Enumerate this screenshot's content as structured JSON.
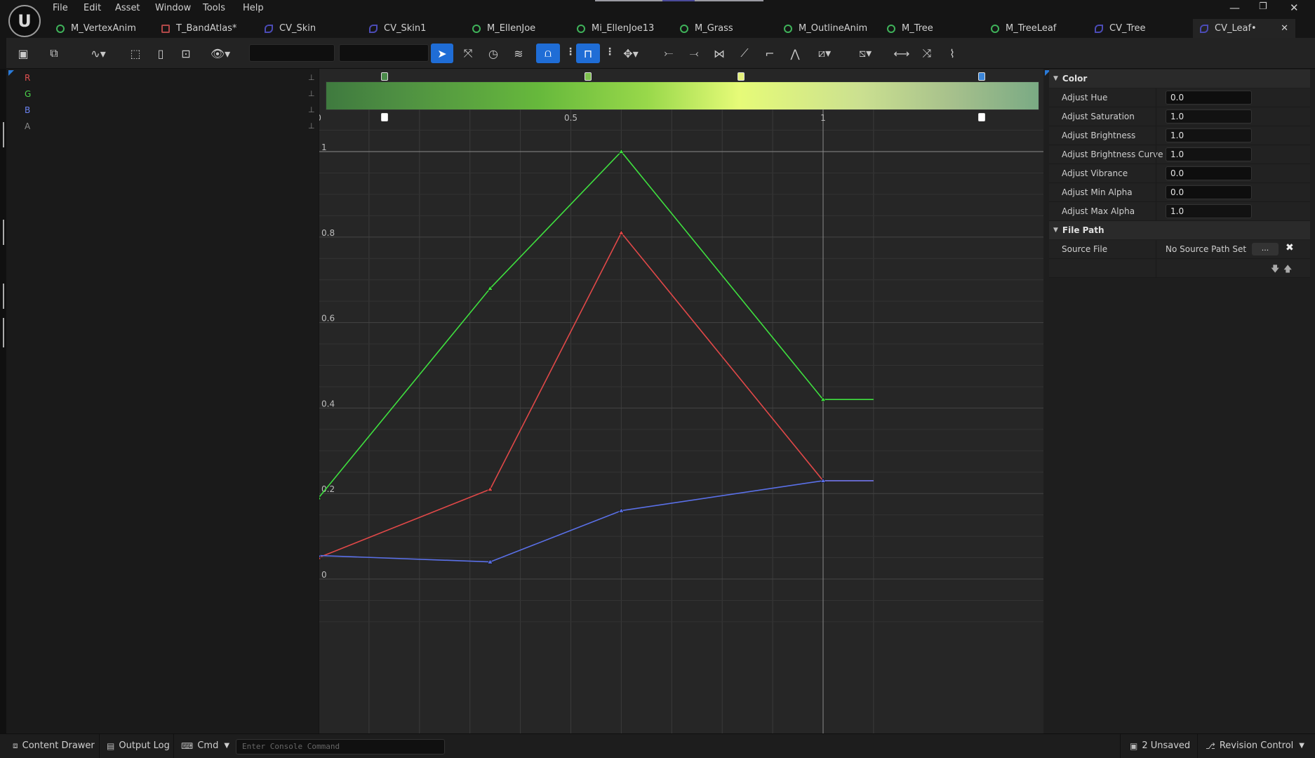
{
  "app": {
    "name": "Unreal Editor"
  },
  "menu": [
    "File",
    "Edit",
    "Asset",
    "Window",
    "Tools",
    "Help"
  ],
  "tabs": [
    {
      "label": "M_VertexAnim",
      "kind": "material"
    },
    {
      "label": "T_BandAtlas*",
      "kind": "texture"
    },
    {
      "label": "CV_Skin",
      "kind": "curve"
    },
    {
      "label": "CV_Skin1",
      "kind": "curve"
    },
    {
      "label": "M_EllenJoe",
      "kind": "material"
    },
    {
      "label": "Mi_EllenJoe13",
      "kind": "material"
    },
    {
      "label": "M_Grass",
      "kind": "material"
    },
    {
      "label": "M_OutlineAnim",
      "kind": "material"
    },
    {
      "label": "M_Tree",
      "kind": "material"
    },
    {
      "label": "M_TreeLeaf",
      "kind": "material"
    },
    {
      "label": "CV_Tree",
      "kind": "curve"
    },
    {
      "label": "CV_Leaf•",
      "kind": "curve",
      "active": true
    }
  ],
  "channels": [
    {
      "label": "R",
      "color": "#e05050"
    },
    {
      "label": "G",
      "color": "#4bd44b"
    },
    {
      "label": "B",
      "color": "#6a82f0"
    },
    {
      "label": "A",
      "color": "#8a8a8a"
    }
  ],
  "gradient_stops_top": [
    {
      "color": "#4a8a4a"
    },
    {
      "color": "#7ec04e"
    },
    {
      "color": "#e4f07a"
    },
    {
      "color": "#3c86d8"
    }
  ],
  "chart_data": {
    "type": "line",
    "title": "",
    "x_ticks": [
      "0",
      "0.5",
      "1"
    ],
    "y_ticks": [
      "0",
      "0.2",
      "0.4",
      "0.6",
      "0.8",
      "1"
    ],
    "xlim": [
      -0.1,
      1.1
    ],
    "ylim": [
      -0.08,
      1.1
    ],
    "series": [
      {
        "name": "G",
        "color": "#3fe03f",
        "points": [
          [
            0,
            0.19
          ],
          [
            0.34,
            0.68
          ],
          [
            0.6,
            1.0
          ],
          [
            1.0,
            0.42
          ]
        ]
      },
      {
        "name": "R",
        "color": "#e04848",
        "points": [
          [
            0,
            0.05
          ],
          [
            0.34,
            0.21
          ],
          [
            0.6,
            0.81
          ],
          [
            1.0,
            0.23
          ]
        ]
      },
      {
        "name": "B",
        "color": "#5a70e8",
        "points": [
          [
            0,
            0.055
          ],
          [
            0.34,
            0.04
          ],
          [
            0.6,
            0.16
          ],
          [
            1.0,
            0.23
          ]
        ]
      }
    ]
  },
  "details": {
    "color_category": "Color",
    "properties": [
      {
        "label": "Adjust Hue",
        "value": "0.0"
      },
      {
        "label": "Adjust Saturation",
        "value": "1.0"
      },
      {
        "label": "Adjust Brightness",
        "value": "1.0"
      },
      {
        "label": "Adjust Brightness Curve",
        "value": "1.0"
      },
      {
        "label": "Adjust Vibrance",
        "value": "0.0"
      },
      {
        "label": "Adjust Min Alpha",
        "value": "0.0"
      },
      {
        "label": "Adjust Max Alpha",
        "value": "1.0"
      }
    ],
    "file_category": "File Path",
    "source_file_label": "Source File",
    "source_file_value": "No Source Path Set",
    "source_button": "..."
  },
  "statusbar": {
    "content_drawer": "Content Drawer",
    "output_log": "Output Log",
    "cmd": "Cmd",
    "console_placeholder": "Enter Console Command",
    "unsaved": "2 Unsaved",
    "revision_control": "Revision Control"
  }
}
